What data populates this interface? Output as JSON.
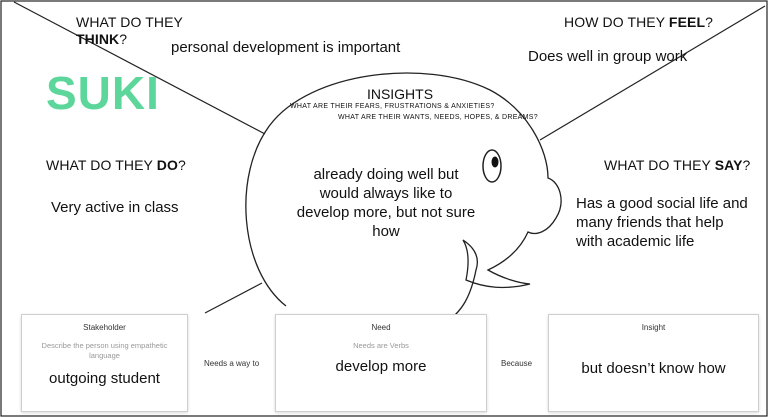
{
  "persona": {
    "name": "SUKI",
    "name_color": "#5cd69a"
  },
  "think": {
    "label_pre": "WHAT DO THEY ",
    "label_emph": "THINK",
    "label_post": "?",
    "answer": "personal development is important"
  },
  "feel": {
    "label_pre": "HOW DO THEY ",
    "label_emph": "FEEL",
    "label_post": "?",
    "answer": "Does well in group work"
  },
  "do": {
    "label_pre": "WHAT DO THEY ",
    "label_emph": "DO",
    "label_post": "?",
    "answer": "Very active in class"
  },
  "say": {
    "label_pre": "WHAT DO THEY ",
    "label_emph": "SAY",
    "label_post": "?",
    "answer_lines": [
      "Has a good social life and",
      "many friends that help",
      "with academic life"
    ]
  },
  "insights": {
    "title": "INSIGHTS",
    "sub1": "WHAT ARE THEIR FEARS, FRUSTRATIONS & ANXIETIES?",
    "sub2": "WHAT ARE THEIR WANTS, NEEDS, HOPES, & DREAMS?",
    "body_lines": [
      "already doing well but",
      "would always like to",
      "develop more, but not sure",
      "how"
    ]
  },
  "statement": {
    "stakeholder": {
      "title": "Stakeholder",
      "hint_lines": [
        "Describe the person using empathetic",
        "language"
      ],
      "value": "outgoing student"
    },
    "connector1": "Needs a way to",
    "need": {
      "title": "Need",
      "hint": "Needs are Verbs",
      "value": "develop more"
    },
    "connector2": "Because",
    "insight": {
      "title": "Insight",
      "value": "but doesn’t know how"
    }
  }
}
